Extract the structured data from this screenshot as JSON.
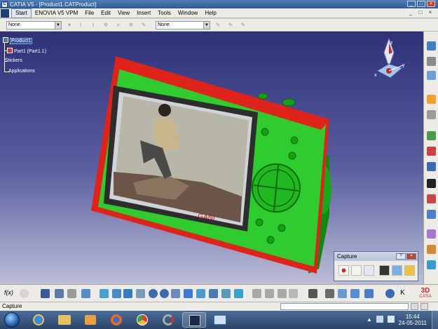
{
  "window": {
    "title": "CATIA V5 - [Product1.CATProduct]",
    "controls": [
      "_",
      "□",
      "×"
    ]
  },
  "menu": {
    "items": [
      "Start",
      "ENOVIA V5 VPM",
      "File",
      "Edit",
      "View",
      "Insert",
      "Tools",
      "Window",
      "Help"
    ],
    "doc_controls": [
      "_",
      "□",
      "×"
    ]
  },
  "filters": {
    "combo1": "None",
    "combo2": "None"
  },
  "tree": {
    "root": "Product1",
    "part": "Part1 (Part1.1)",
    "stickers": "Stickers",
    "applications": "Applications"
  },
  "compass": {
    "x_label": "x",
    "y_label": "y",
    "z_label": "z"
  },
  "model": {
    "photo_caption": "GANI",
    "colors": {
      "body": "#2ecc2e",
      "frame": "#e0221a",
      "screen": "#cfd3d8"
    }
  },
  "capture": {
    "title": "Capture",
    "controls": [
      "?",
      "×"
    ]
  },
  "statusbar": {
    "text": "Capture"
  },
  "taskbar": {
    "time": "15:44",
    "date": "24-05-2011",
    "brand": "CATIA"
  }
}
